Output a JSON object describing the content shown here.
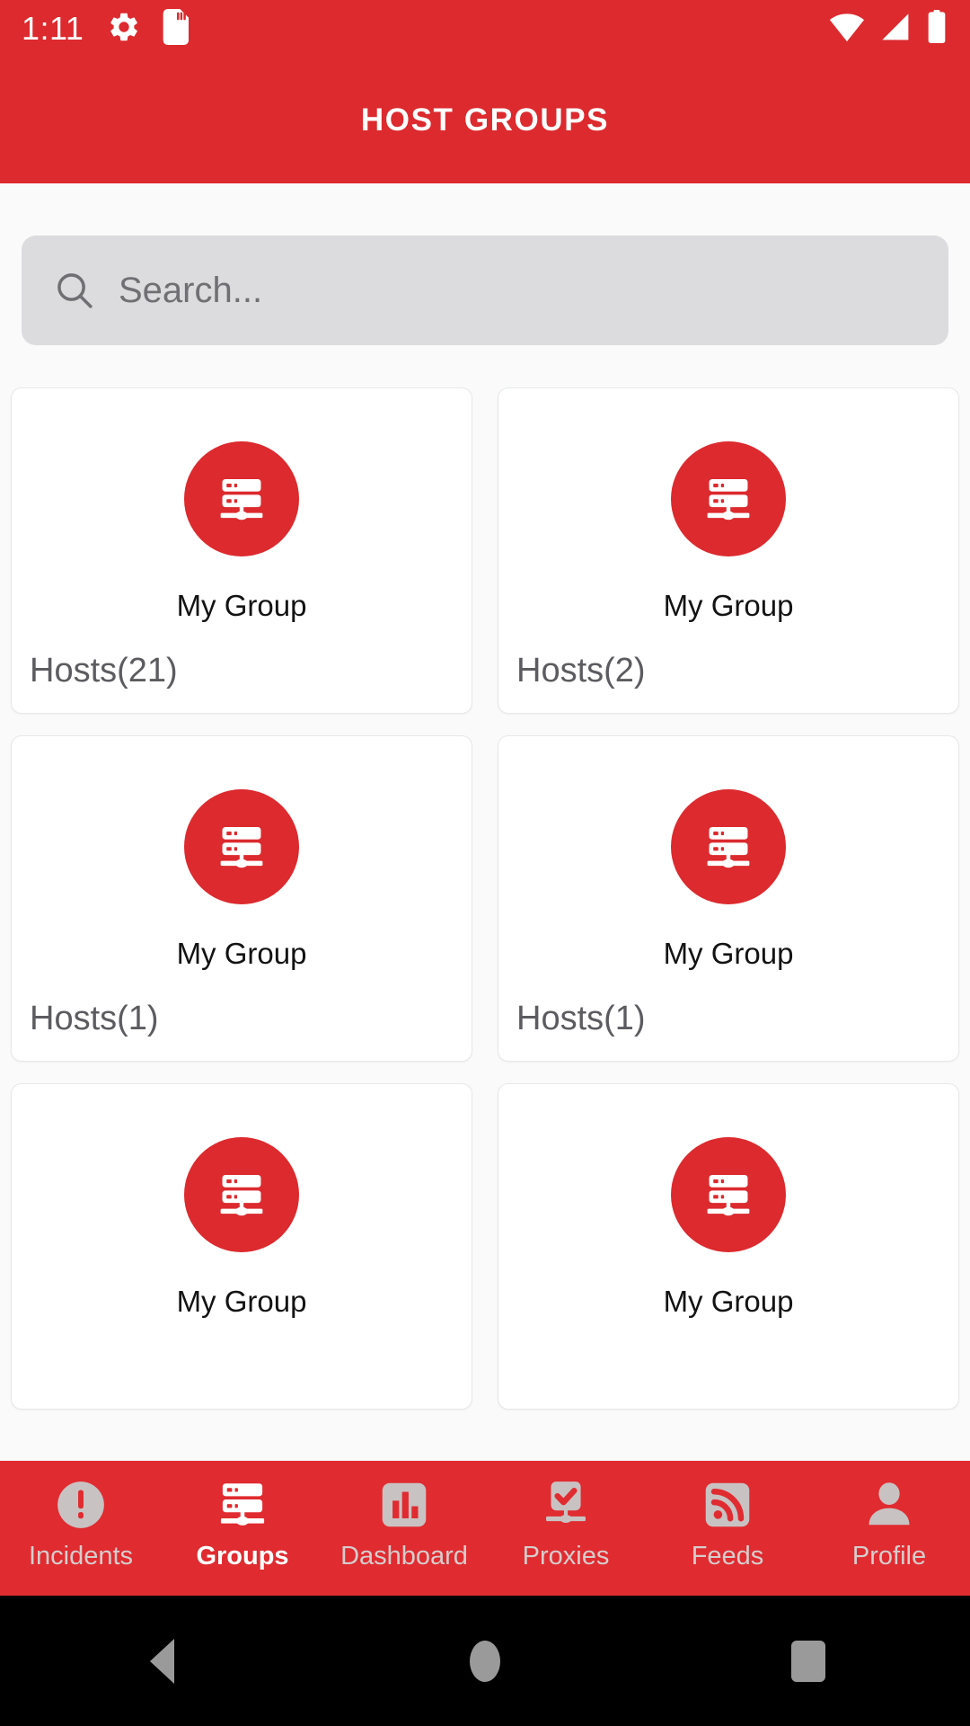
{
  "status_bar": {
    "time": "1:11",
    "left_icons": [
      "settings-gear-icon",
      "sd-card-icon"
    ],
    "right_icons": [
      "wifi-icon",
      "cellular-signal-icon",
      "battery-icon"
    ]
  },
  "app_bar": {
    "title": "HOST GROUPS"
  },
  "search": {
    "placeholder": "Search...",
    "value": "",
    "icon": "search-icon"
  },
  "colors": {
    "brand_red": "#DC2A2E",
    "nav_red": "#E02B30",
    "page_background": "#fafafa",
    "card_background": "#ffffff",
    "card_border": "#e6e8e9",
    "search_background": "#dcdcdf",
    "search_placeholder_text": "#6f6f74",
    "card_title_text": "#131313",
    "card_hosts_text": "#5c5c60",
    "nav_inactive_text": "#d6cdcd",
    "nav_active_text": "#ffffff",
    "android_nav_background": "#000000",
    "android_nav_icon": "#9a9a9a"
  },
  "groups": [
    {
      "name": "My Group",
      "hosts_label": "Hosts(21)",
      "hosts_count": 21,
      "icon": "server-rack-icon"
    },
    {
      "name": "My Group",
      "hosts_label": "Hosts(2)",
      "hosts_count": 2,
      "icon": "server-rack-icon"
    },
    {
      "name": "My Group",
      "hosts_label": "Hosts(1)",
      "hosts_count": 1,
      "icon": "server-rack-icon"
    },
    {
      "name": "My Group",
      "hosts_label": "Hosts(1)",
      "hosts_count": 1,
      "icon": "server-rack-icon"
    },
    {
      "name": "My Group",
      "hosts_label": "",
      "hosts_count": null,
      "icon": "server-rack-icon"
    },
    {
      "name": "My Group",
      "hosts_label": "",
      "hosts_count": null,
      "icon": "server-rack-icon"
    }
  ],
  "bottom_nav": {
    "active_index": 1,
    "items": [
      {
        "label": "Incidents",
        "icon": "alert-exclamation-circle-icon"
      },
      {
        "label": "Groups",
        "icon": "server-rack-icon"
      },
      {
        "label": "Dashboard",
        "icon": "bar-chart-icon"
      },
      {
        "label": "Proxies",
        "icon": "proxy-check-icon"
      },
      {
        "label": "Feeds",
        "icon": "rss-feed-icon"
      },
      {
        "label": "Profile",
        "icon": "person-icon"
      }
    ]
  },
  "android_nav": {
    "back": "back-triangle-icon",
    "home": "home-circle-icon",
    "recents": "recents-square-icon"
  }
}
